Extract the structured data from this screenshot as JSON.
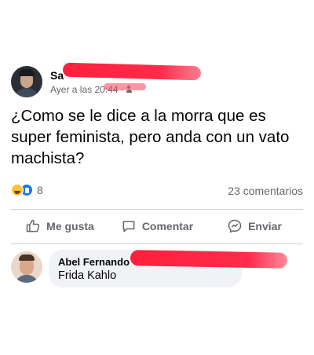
{
  "post": {
    "author_visible": "Sa",
    "timestamp": "Ayer a las 20:44",
    "audience_icon": "friends-icon",
    "text": "¿Como se le dice a la morra que es super feminista, pero anda con un vato machista?",
    "reactions": {
      "icons": [
        "haha-reaction-icon",
        "like-reaction-icon"
      ],
      "count": "8"
    },
    "comments_count": "23 comentarios"
  },
  "actions": {
    "like": "Me gusta",
    "comment": "Comentar",
    "share": "Enviar"
  },
  "comment": {
    "author_visible": "Abel Fernando",
    "text": "Frida Kahlo"
  },
  "colors": {
    "redaction": "#ff2040",
    "like_blue": "#1877f2",
    "secondary_text": "#65676b",
    "bubble_bg": "#f0f2f5"
  }
}
